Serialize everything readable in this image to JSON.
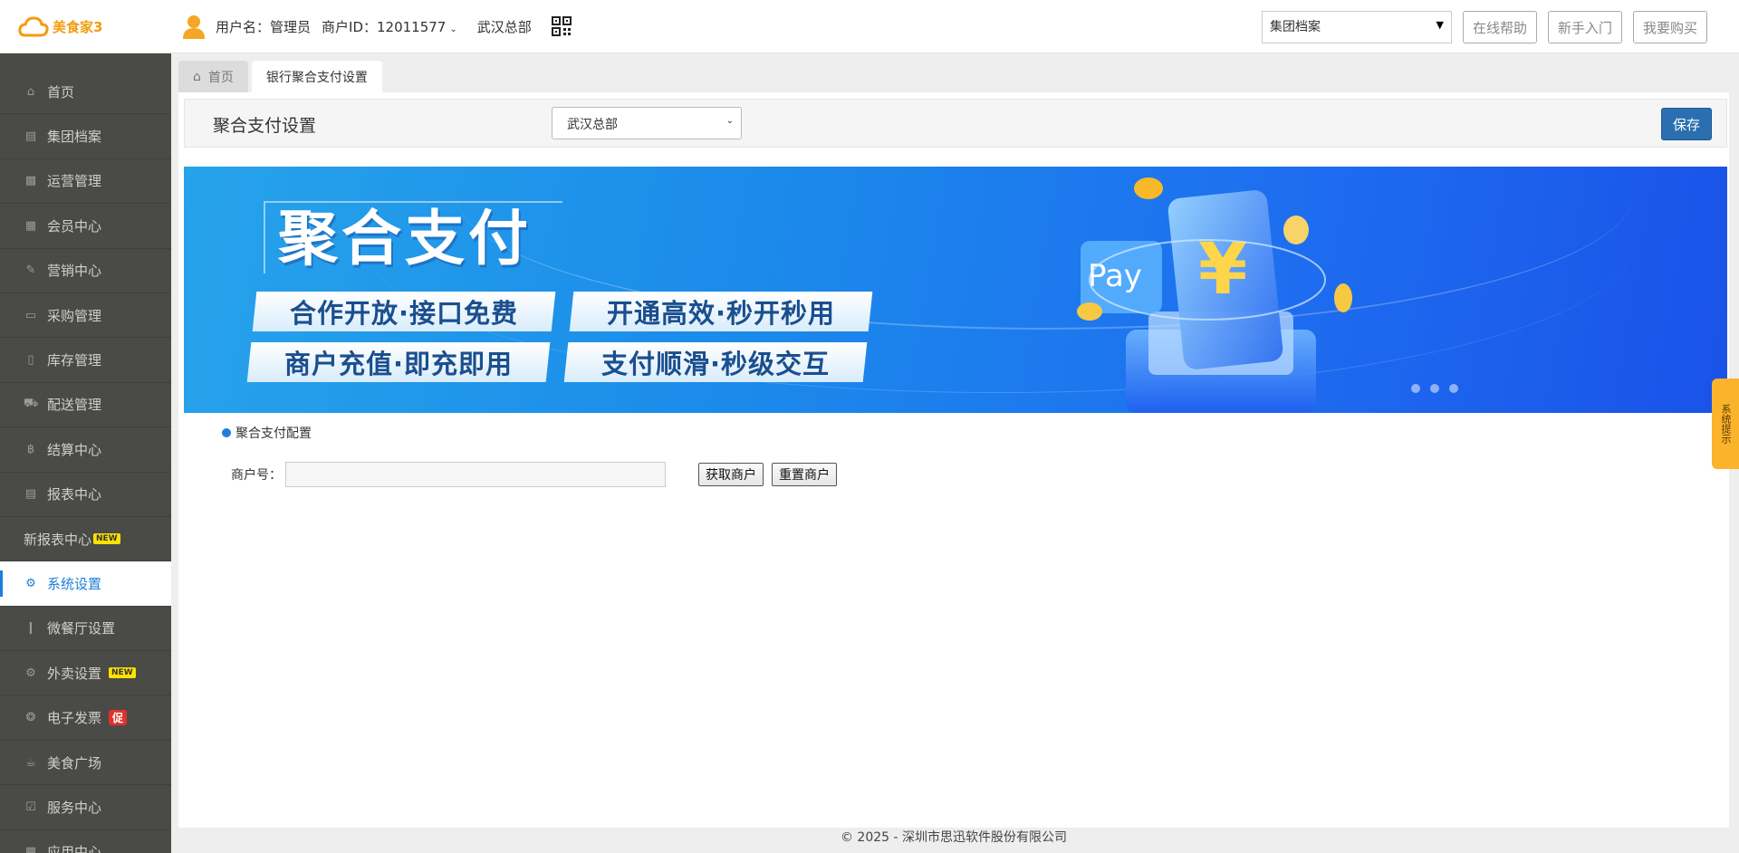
{
  "header": {
    "logo_text": "美食家3",
    "username": "用户名：管理员",
    "merchant_id": "商户ID：12011577",
    "store": "武汉总部",
    "module_select": "集团档案",
    "buttons": [
      "在线帮助",
      "新手入门",
      "我要购买"
    ]
  },
  "sidebar": {
    "items": [
      {
        "label": "首页",
        "icon": "home-icon"
      },
      {
        "label": "集团档案",
        "icon": "file-icon"
      },
      {
        "label": "运营管理",
        "icon": "bar-chart-icon"
      },
      {
        "label": "会员中心",
        "icon": "id-card-icon"
      },
      {
        "label": "营销中心",
        "icon": "edit-icon"
      },
      {
        "label": "采购管理",
        "icon": "book-icon"
      },
      {
        "label": "库存管理",
        "icon": "tablet-icon"
      },
      {
        "label": "配送管理",
        "icon": "truck-icon"
      },
      {
        "label": "结算中心",
        "icon": "bitcoin-icon"
      },
      {
        "label": "报表中心",
        "icon": "report-icon"
      },
      {
        "label": "新报表中心",
        "badge": "NEW"
      },
      {
        "label": "系统设置",
        "icon": "cogs-icon",
        "active": true
      },
      {
        "label": "微餐厅设置",
        "icon": "cutlery-icon"
      },
      {
        "label": "外卖设置",
        "icon": "gear-icon",
        "badge": "NEW"
      },
      {
        "label": "电子发票",
        "icon": "compass-icon",
        "badge": "促"
      },
      {
        "label": "美食广场",
        "icon": "coffee-icon"
      },
      {
        "label": "服务中心",
        "icon": "check-square-icon"
      },
      {
        "label": "应用中心",
        "icon": "grid-icon"
      }
    ]
  },
  "tabs": [
    {
      "label": "首页"
    },
    {
      "label": "银行聚合支付设置"
    }
  ],
  "toolbar": {
    "title": "聚合支付设置",
    "store_select": "武汉总部",
    "save_label": "保存"
  },
  "banner": {
    "title": "聚合支付",
    "slogans": [
      "合作开放·接口免费",
      "开通高效·秒开秒用",
      "商户充值·即充即用",
      "支付顺滑·秒级交互"
    ],
    "pay_text": "Pay",
    "currency_symbol": "¥",
    "carousel_dots": 3
  },
  "config": {
    "section_title": "聚合支付配置",
    "merchant_label": "商户号：",
    "merchant_value": "",
    "get_btn": "获取商户",
    "reset_btn": "重置商户"
  },
  "side_tip": "系统提示",
  "footer": "© 2025 - 深圳市思迅软件股份有限公司",
  "colors": {
    "accent": "#1e7ed8",
    "sidebar_bg": "#4a4a47",
    "save_button": "#2b6fb1",
    "logo": "#f39c12",
    "badge_new": "#ffe100",
    "badge_promo": "#e0322d",
    "tip": "#fbb32b"
  }
}
